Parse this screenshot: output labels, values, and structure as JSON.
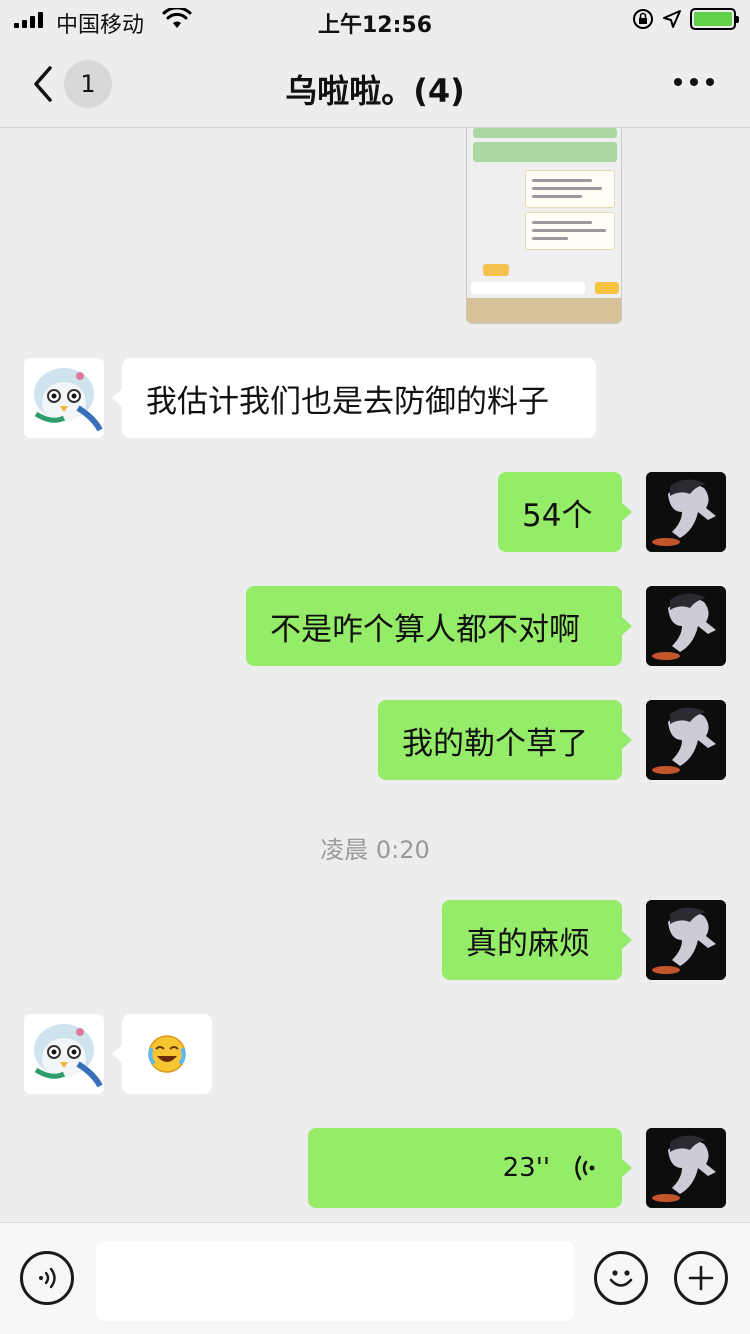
{
  "status_bar": {
    "carrier": "中国移动",
    "time": "上午12:56"
  },
  "nav": {
    "unread_count": "1",
    "title": "乌啦啦。(4)"
  },
  "messages": [
    {
      "id": "m1",
      "side": "in",
      "type": "text",
      "text": "我估计我们也是去防御的料子"
    },
    {
      "id": "m2",
      "side": "out",
      "type": "text",
      "text": "54个"
    },
    {
      "id": "m3",
      "side": "out",
      "type": "text",
      "text": "不是咋个算人都不对啊"
    },
    {
      "id": "m4",
      "side": "out",
      "type": "text",
      "text": "我的勒个草了"
    },
    {
      "id": "m5",
      "side": "out",
      "type": "text",
      "text": "真的麻烦"
    },
    {
      "id": "m6",
      "side": "in",
      "type": "emoji",
      "emoji": "crying-laughing"
    },
    {
      "id": "m7",
      "side": "out",
      "type": "voice",
      "duration": "23''"
    }
  ],
  "timestamp": "凌晨 0:20",
  "input": {
    "value": "",
    "placeholder": ""
  },
  "icons": {
    "back": "chevron-left-icon",
    "more": "ellipsis-icon",
    "voice_toggle": "voice-input-icon",
    "emoji": "smiley-icon",
    "add": "plus-icon"
  },
  "colors": {
    "background": "#ededed",
    "outgoing_bubble": "#95ec69",
    "incoming_bubble": "#ffffff",
    "battery_fill": "#5fd048"
  }
}
